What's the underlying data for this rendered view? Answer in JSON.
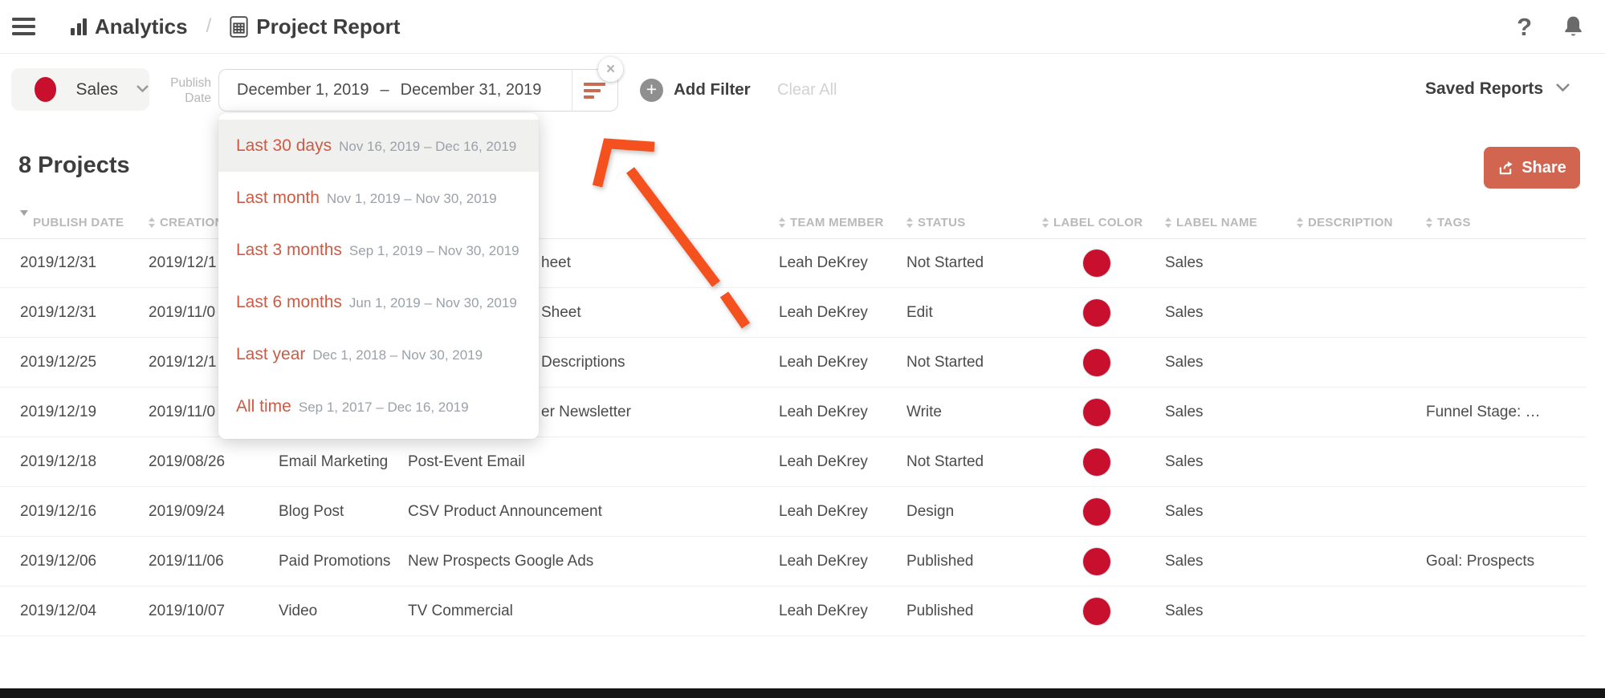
{
  "icons": {
    "close": "×",
    "plus": "+",
    "help": "?"
  },
  "breadcrumb": {
    "section": "Analytics",
    "separator": "/",
    "page": "Project Report"
  },
  "filter_bar": {
    "label_filter": {
      "text": "Sales",
      "dot_color": "#c8102e"
    },
    "field_label": {
      "line1": "Publish",
      "line2": "Date"
    },
    "date_range": {
      "start": "December 1, 2019",
      "dash": "–",
      "end": "December 31, 2019"
    },
    "add_filter": "Add Filter",
    "clear_all": "Clear All",
    "saved_reports": "Saved Reports"
  },
  "date_preset_menu": {
    "items": [
      {
        "label": "Last 30 days",
        "range": "Nov 16, 2019 – Dec 16, 2019",
        "highlighted": true
      },
      {
        "label": "Last month",
        "range": "Nov 1, 2019 – Nov 30, 2019",
        "highlighted": false
      },
      {
        "label": "Last 3 months",
        "range": "Sep 1, 2019 – Nov 30, 2019",
        "highlighted": false
      },
      {
        "label": "Last 6 months",
        "range": "Jun 1, 2019 – Nov 30, 2019",
        "highlighted": false
      },
      {
        "label": "Last year",
        "range": "Dec 1, 2018 – Nov 30, 2019",
        "highlighted": false
      },
      {
        "label": "All time",
        "range": "Sep 1, 2017 – Dec 16, 2019",
        "highlighted": false
      }
    ]
  },
  "results": {
    "count_title": "8 Projects",
    "share_label": "Share"
  },
  "table": {
    "label_dot_color": "#c8102e",
    "columns": [
      {
        "key": "pd",
        "label": "PUBLISH DATE",
        "sort": "desc"
      },
      {
        "key": "cd",
        "label": "CREATION DATE",
        "sort": "both"
      },
      {
        "key": "ct",
        "label": "",
        "sort": "none"
      },
      {
        "key": "name",
        "label": "",
        "sort": "none"
      },
      {
        "key": "tm",
        "label": "TEAM MEMBER",
        "sort": "both"
      },
      {
        "key": "st",
        "label": "STATUS",
        "sort": "both"
      },
      {
        "key": "lc",
        "label": "LABEL COLOR",
        "sort": "both"
      },
      {
        "key": "ln",
        "label": "LABEL NAME",
        "sort": "both"
      },
      {
        "key": "desc",
        "label": "DESCRIPTION",
        "sort": "both"
      },
      {
        "key": "tags",
        "label": "TAGS",
        "sort": "both"
      }
    ],
    "rows": [
      {
        "pd": "2019/12/31",
        "cd": "2019/12/1",
        "ct": "",
        "name": "heet",
        "tm": "Leah DeKrey",
        "st": "Not Started",
        "ln": "Sales",
        "desc": "",
        "tags": "",
        "covered": true
      },
      {
        "pd": "2019/12/31",
        "cd": "2019/11/0",
        "ct": "",
        "name": "Sheet",
        "tm": "Leah DeKrey",
        "st": "Edit",
        "ln": "Sales",
        "desc": "",
        "tags": "",
        "covered": true
      },
      {
        "pd": "2019/12/25",
        "cd": "2019/12/1",
        "ct": "",
        "name": "Descriptions",
        "tm": "Leah DeKrey",
        "st": "Not Started",
        "ln": "Sales",
        "desc": "",
        "tags": "",
        "covered": true
      },
      {
        "pd": "2019/12/19",
        "cd": "2019/11/0",
        "ct": "",
        "name": "er Newsletter",
        "tm": "Leah DeKrey",
        "st": "Write",
        "ln": "Sales",
        "desc": "",
        "tags": "Funnel Stage: …",
        "covered": true
      },
      {
        "pd": "2019/12/18",
        "cd": "2019/08/26",
        "ct": "Email Marketing",
        "name": "Post-Event Email",
        "tm": "Leah DeKrey",
        "st": "Not Started",
        "ln": "Sales",
        "desc": "",
        "tags": "",
        "covered": false
      },
      {
        "pd": "2019/12/16",
        "cd": "2019/09/24",
        "ct": "Blog Post",
        "name": "CSV Product Announcement",
        "tm": "Leah DeKrey",
        "st": "Design",
        "ln": "Sales",
        "desc": "",
        "tags": "",
        "covered": false
      },
      {
        "pd": "2019/12/06",
        "cd": "2019/11/06",
        "ct": "Paid Promotions",
        "name": "New Prospects Google Ads",
        "tm": "Leah DeKrey",
        "st": "Published",
        "ln": "Sales",
        "desc": "",
        "tags": "Goal: Prospects",
        "covered": false
      },
      {
        "pd": "2019/12/04",
        "cd": "2019/10/07",
        "ct": "Video",
        "name": "TV Commercial",
        "tm": "Leah DeKrey",
        "st": "Published",
        "ln": "Sales",
        "desc": "",
        "tags": "",
        "covered": false
      }
    ]
  },
  "annotation": {
    "color": "#f4511e"
  }
}
